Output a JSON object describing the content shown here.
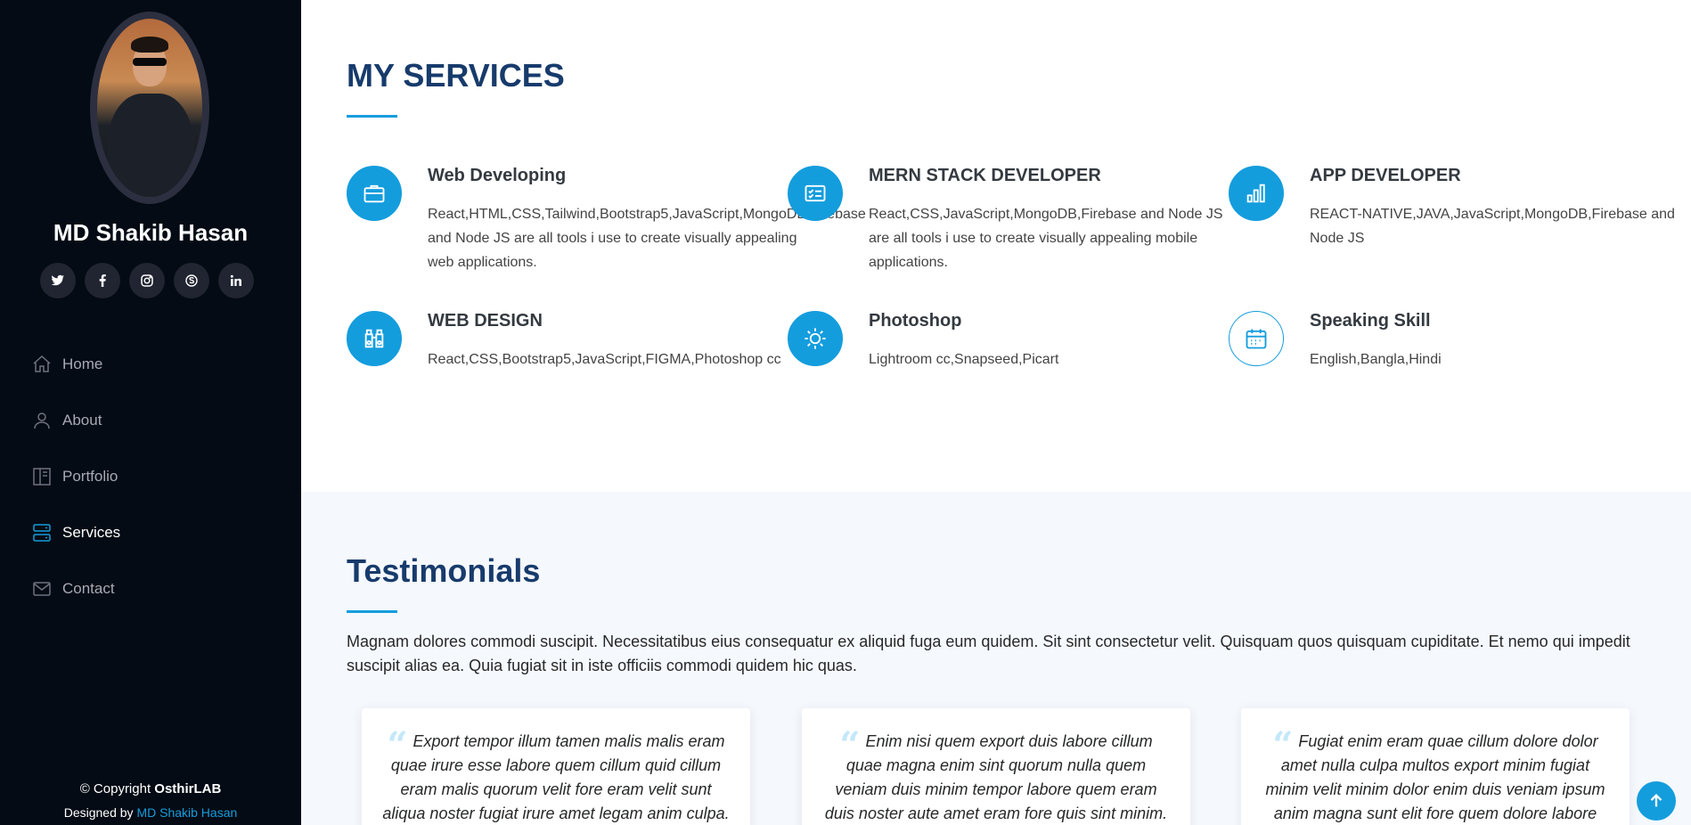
{
  "profile": {
    "name": "MD Shakib Hasan"
  },
  "social": [
    {
      "icon": "twitter-icon"
    },
    {
      "icon": "facebook-icon"
    },
    {
      "icon": "instagram-icon"
    },
    {
      "icon": "skype-icon"
    },
    {
      "icon": "linkedin-icon"
    }
  ],
  "nav": {
    "items": [
      {
        "label": "Home",
        "icon": "home-icon"
      },
      {
        "label": "About",
        "icon": "person-icon"
      },
      {
        "label": "Portfolio",
        "icon": "portfolio-icon"
      },
      {
        "label": "Services",
        "icon": "server-icon",
        "active": true
      },
      {
        "label": "Contact",
        "icon": "envelope-icon"
      }
    ]
  },
  "footer": {
    "copyright_prefix": "© Copyright",
    "brand": "OsthirLAB",
    "designed_prefix": "Designed by",
    "designer": "MD Shakib Hasan"
  },
  "services": {
    "title": "MY SERVICES",
    "items": [
      {
        "title": "Web Developing",
        "desc": "React,HTML,CSS,Tailwind,Bootstrap5,JavaScript,MongoDB,Firebase and Node JS are all tools i use to create visually appealing web applications.",
        "icon": "briefcase-icon"
      },
      {
        "title": "MERN STACK DEVELOPER",
        "desc": "React,CSS,JavaScript,MongoDB,Firebase and Node JS are all tools i use to create visually appealing mobile applications.",
        "icon": "card-checklist-icon"
      },
      {
        "title": "APP DEVELOPER",
        "desc": "REACT-NATIVE,JAVA,JavaScript,MongoDB,Firebase and Node JS",
        "icon": "bar-chart-icon"
      },
      {
        "title": "WEB DESIGN",
        "desc": "React,CSS,Bootstrap5,JavaScript,FIGMA,Photoshop cc",
        "icon": "binoculars-icon"
      },
      {
        "title": "Photoshop",
        "desc": "Lightroom cc,Snapseed,Picart",
        "icon": "brightness-icon"
      },
      {
        "title": "Speaking Skill",
        "desc": "English,Bangla,Hindi",
        "icon": "calendar-icon"
      }
    ]
  },
  "testimonials": {
    "title": "Testimonials",
    "intro": "Magnam dolores commodi suscipit. Necessitatibus eius consequatur ex aliquid fuga eum quidem. Sit sint consectetur velit. Quisquam quos quisquam cupiditate. Et nemo qui impedit suscipit alias ea. Quia fugiat sit in iste officiis commodi quidem hic quas.",
    "cards": [
      {
        "text": "Export tempor illum tamen malis malis eram quae irure esse labore quem cillum quid cillum eram malis quorum velit fore eram velit sunt aliqua noster fugiat irure amet legam anim culpa."
      },
      {
        "text": "Enim nisi quem export duis labore cillum quae magna enim sint quorum nulla quem veniam duis minim tempor labore quem eram duis noster aute amet eram fore quis sint minim."
      },
      {
        "text": "Fugiat enim eram quae cillum dolore dolor amet nulla culpa multos export minim fugiat minim velit minim dolor enim duis veniam ipsum anim magna sunt elit fore quem dolore labore"
      }
    ]
  },
  "colors": {
    "accent": "#149ddd",
    "sidebar": "#040b14",
    "heading": "#173b6c"
  }
}
